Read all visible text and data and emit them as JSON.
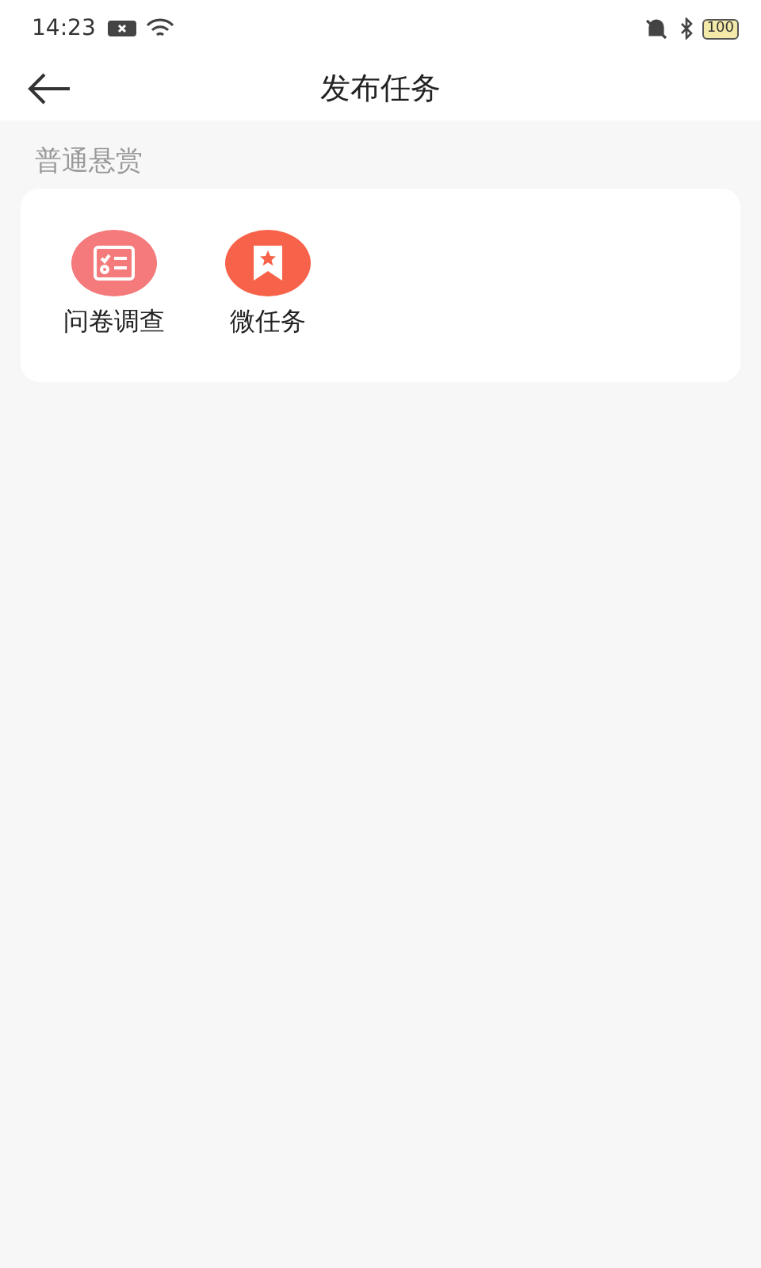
{
  "status_bar": {
    "time": "14:23",
    "battery": "100"
  },
  "header": {
    "title": "发布任务"
  },
  "section": {
    "title": "普通悬赏",
    "items": [
      {
        "label": "问卷调查",
        "kind": "survey",
        "color": "#f47a7b"
      },
      {
        "label": "微任务",
        "kind": "task",
        "color": "#f6634a"
      }
    ]
  }
}
